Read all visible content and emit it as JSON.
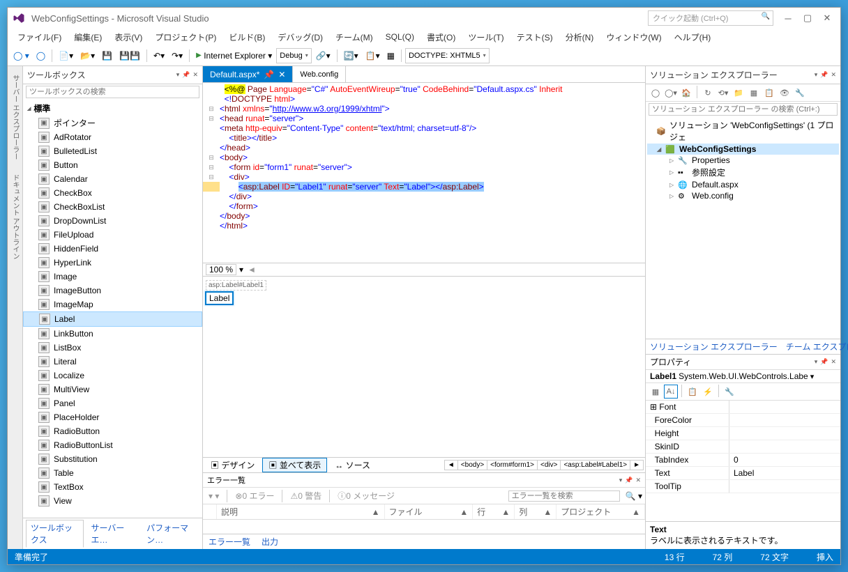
{
  "title": "WebConfigSettings - Microsoft Visual Studio",
  "quickLaunch": "クイック起動 (Ctrl+Q)",
  "menu": [
    "ファイル(F)",
    "編集(E)",
    "表示(V)",
    "プロジェクト(P)",
    "ビルド(B)",
    "デバッグ(D)",
    "チーム(M)",
    "SQL(Q)",
    "書式(O)",
    "ツール(T)",
    "テスト(S)",
    "分析(N)",
    "ウィンドウ(W)",
    "ヘルプ(H)"
  ],
  "toolbar": {
    "browser": "Internet Explorer",
    "config": "Debug",
    "doctype": "DOCTYPE: XHTML5"
  },
  "sideTabs": [
    "サーバー エクスプローラー",
    "ドキュメント アウトライン"
  ],
  "toolbox": {
    "title": "ツールボックス",
    "search": "ツールボックスの検索",
    "category": "標準",
    "items": [
      "ポインター",
      "AdRotator",
      "BulletedList",
      "Button",
      "Calendar",
      "CheckBox",
      "CheckBoxList",
      "DropDownList",
      "FileUpload",
      "HiddenField",
      "HyperLink",
      "Image",
      "ImageButton",
      "ImageMap",
      "Label",
      "LinkButton",
      "ListBox",
      "Literal",
      "Localize",
      "MultiView",
      "Panel",
      "PlaceHolder",
      "RadioButton",
      "RadioButtonList",
      "Substitution",
      "Table",
      "TextBox",
      "View"
    ],
    "selected": "Label",
    "tabs": [
      "ツールボックス",
      "サーバー エ…",
      "パフォーマン…"
    ]
  },
  "docTabs": [
    {
      "name": "Default.aspx*",
      "pinned": true,
      "active": true
    },
    {
      "name": "Web.config",
      "pinned": false,
      "active": false
    }
  ],
  "zoom": "100 %",
  "pathCrumb": "asp:Label#Label1",
  "labelText": "Label",
  "viewButtons": {
    "design": "デザイン",
    "split": "並べて表示",
    "source": "ソース"
  },
  "breadcrumb": [
    "◄",
    "<body>",
    "<form#form1>",
    "<div>",
    "<asp:Label#Label1>",
    "►"
  ],
  "errorList": {
    "title": "エラー一覧",
    "errors": "0 エラー",
    "warnings": "0 警告",
    "messages": "0 メッセージ",
    "search": "エラー一覧を検索",
    "cols": [
      "",
      "説明",
      "ファイル",
      "行",
      "列",
      "プロジェクト"
    ],
    "tabs": [
      "エラー一覧",
      "出力"
    ]
  },
  "solution": {
    "title": "ソリューション エクスプローラー",
    "search": "ソリューション エクスプローラー の検索 (Ctrl+:)",
    "root": "ソリューション 'WebConfigSettings' (1 プロジェ",
    "project": "WebConfigSettings",
    "nodes": [
      "Properties",
      "参照設定",
      "Default.aspx",
      "Web.config"
    ],
    "tabs": [
      "ソリューション エクスプローラー",
      "チーム エクスプローラー"
    ]
  },
  "props": {
    "title": "プロパティ",
    "obj": "Label1",
    "objType": "System.Web.UI.WebControls.Labe",
    "rows": [
      {
        "n": "Font",
        "v": ""
      },
      {
        "n": "ForeColor",
        "v": ""
      },
      {
        "n": "Height",
        "v": ""
      },
      {
        "n": "SkinID",
        "v": ""
      },
      {
        "n": "TabIndex",
        "v": "0"
      },
      {
        "n": "Text",
        "v": "Label"
      },
      {
        "n": "ToolTip",
        "v": ""
      }
    ],
    "descName": "Text",
    "descText": "ラベルに表示されるテキストです。"
  },
  "status": {
    "ready": "準備完了",
    "line": "13 行",
    "col": "72 列",
    "ch": "72 文字",
    "mode": "挿入"
  }
}
